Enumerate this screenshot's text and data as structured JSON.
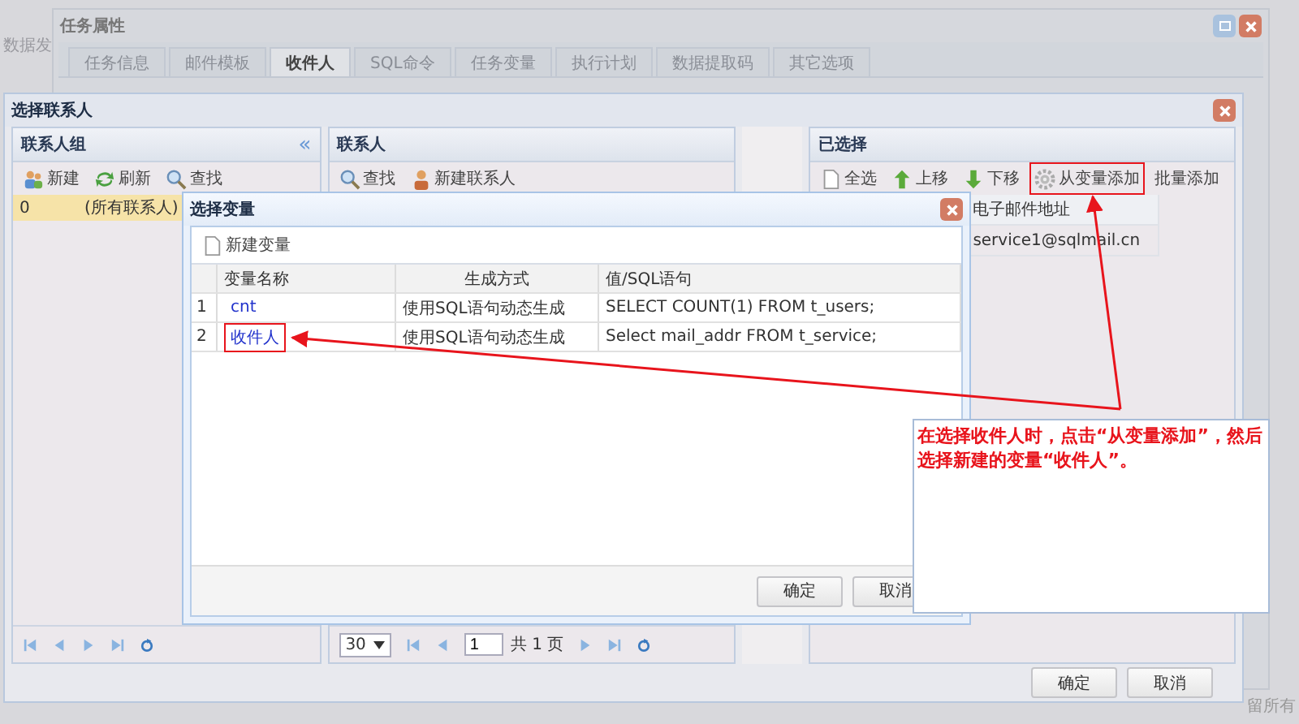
{
  "background": {
    "side_text": "数据发",
    "footer_text": "留所有"
  },
  "task_window": {
    "title": "任务属性",
    "tabs": [
      {
        "label": "任务信息",
        "selected": false
      },
      {
        "label": "邮件模板",
        "selected": false
      },
      {
        "label": "收件人",
        "selected": true
      },
      {
        "label": "SQL命令",
        "selected": false
      },
      {
        "label": "任务变量",
        "selected": false
      },
      {
        "label": "执行计划",
        "selected": false
      },
      {
        "label": "数据提取码",
        "selected": false
      },
      {
        "label": "其它选项",
        "selected": false
      }
    ]
  },
  "contact_dialog": {
    "title": "选择联系人",
    "groups_panel": {
      "title": "联系人组",
      "collapse": "«",
      "toolbar": [
        {
          "label": "新建",
          "kind": "people"
        },
        {
          "label": "刷新",
          "kind": "refresh"
        },
        {
          "label": "查找",
          "kind": "search"
        }
      ],
      "rows": [
        {
          "id": "0",
          "name": "(所有联系人)",
          "selected": true
        }
      ]
    },
    "contacts_panel": {
      "title": "联系人",
      "toolbar": [
        {
          "label": "查找",
          "kind": "search"
        },
        {
          "label": "新建联系人",
          "kind": "person"
        }
      ],
      "pager": {
        "page_size": "30",
        "page": "1",
        "total": "共 1 页"
      }
    },
    "selected_panel": {
      "title": "已选择",
      "toolbar": [
        {
          "label": "全选",
          "kind": "page",
          "highlighted": false
        },
        {
          "label": "上移",
          "kind": "up",
          "highlighted": false
        },
        {
          "label": "下移",
          "kind": "down",
          "highlighted": false
        },
        {
          "label": "从变量添加",
          "kind": "gear",
          "highlighted": true
        },
        {
          "label": "批量添加",
          "kind": "none",
          "highlighted": false
        }
      ],
      "columns": [
        "电子邮件地址"
      ],
      "rows": [
        "service1@sqlmail.cn"
      ]
    },
    "buttons": [
      "确定",
      "取消"
    ]
  },
  "variable_dialog": {
    "title": "选择变量",
    "toolbar": "新建变量",
    "columns": [
      "变量名称",
      "生成方式",
      "值/SQL语句"
    ],
    "rows": [
      {
        "number": "1",
        "name": "cnt",
        "highlighted": false,
        "method": "使用SQL语句动态生成",
        "value": "SELECT COUNT(1) FROM t_users;"
      },
      {
        "number": "2",
        "name": "收件人",
        "highlighted": true,
        "method": "使用SQL语句动态生成",
        "value": "Select mail_addr FROM t_service;"
      }
    ],
    "buttons": [
      "确定",
      "取消"
    ]
  },
  "annotation": {
    "text": "在选择收件人时，点击“从变量添加”，然后选择新建的变量“收件人”。"
  }
}
